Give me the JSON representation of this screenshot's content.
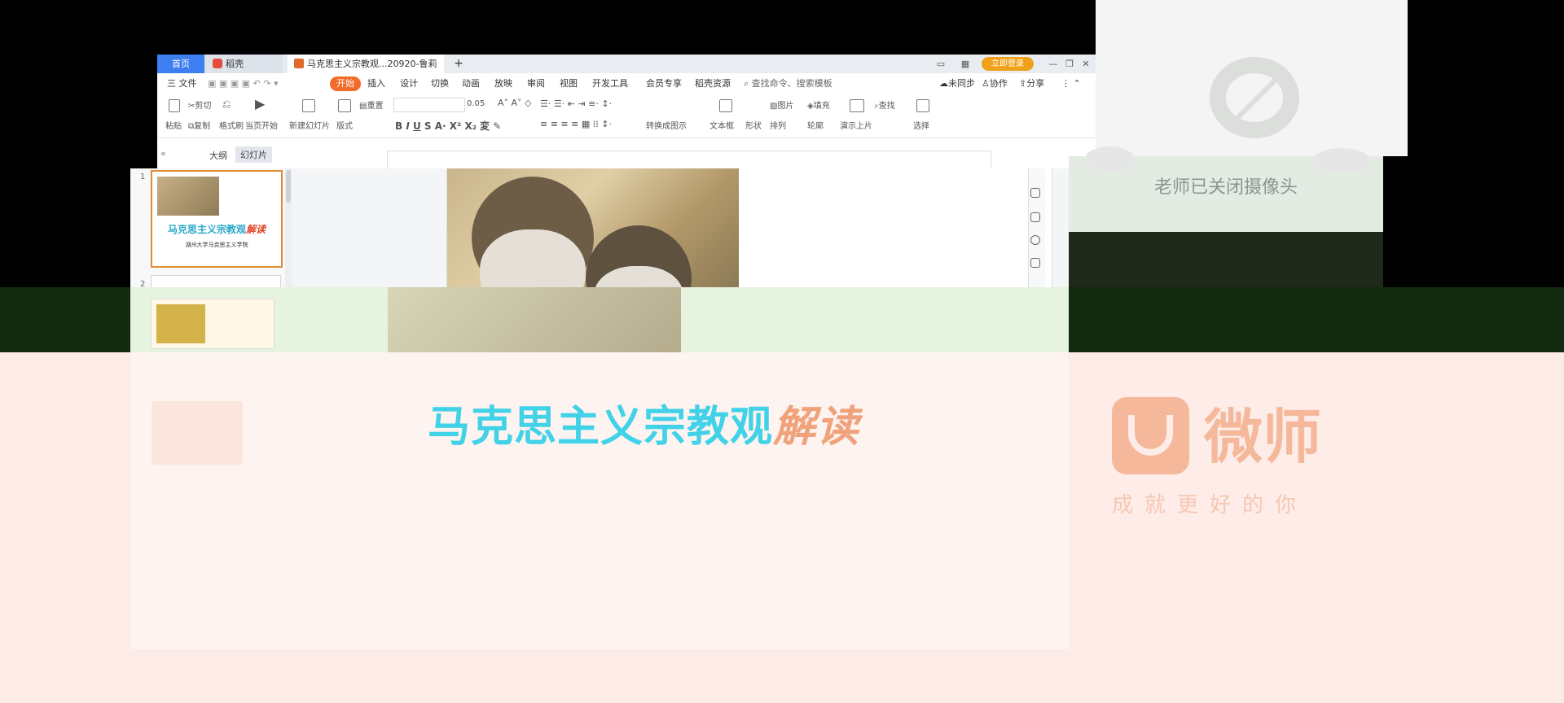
{
  "tabs": {
    "home": "首页",
    "docer": "稻壳",
    "document": "马克思主义宗教观...20920-鲁莉",
    "add": "+"
  },
  "window": {
    "login": "立即登录",
    "minimize": "—",
    "restore": "❐",
    "close": "✕"
  },
  "menu": {
    "file": "三 文件",
    "start": "开始",
    "insert": "插入",
    "design": "设计",
    "transition": "切换",
    "animation": "动画",
    "slideshow": "放映",
    "review": "审阅",
    "view": "视图",
    "developer": "开发工具",
    "member": "会员专享",
    "resources": "稻壳资源",
    "search": "查找命令、搜索模板",
    "unsync": "未同步",
    "collab": "协作",
    "share": "分享"
  },
  "ribbon": {
    "paste": "粘贴",
    "cut": "剪切",
    "copy": "复制",
    "format_painter": "格式刷",
    "play_from_start": "当页开始",
    "new_slide": "新建幻灯片",
    "layout": "版式",
    "reset": "重置",
    "font_size": "0.05",
    "text_box": "文本框",
    "shape": "形状",
    "arrange": "排列",
    "picture": "图片",
    "fill": "填充",
    "find": "查找",
    "present": "演示上片",
    "select": "选择",
    "smartart": "转换成图示",
    "outline": "轮廓"
  },
  "panel": {
    "outline_tab": "大纲",
    "slides_tab": "幻灯片"
  },
  "thumbnails": [
    {
      "number": "1",
      "title": "马克思主义宗教观",
      "title_accent": "解读",
      "subtitle": "湖州大学马克思主义学院"
    },
    {
      "number": "2"
    }
  ],
  "slide": {
    "title": "马克思主义宗教观",
    "title_accent": "解读"
  },
  "camera": {
    "status": "老师已关闭摄像头"
  },
  "brand": {
    "name": "微师",
    "slogan": "成就更好的你"
  },
  "colors": {
    "accent_orange": "#f26b2a",
    "tab_blue": "#3d7ef0",
    "title_cyan": "#42d2e8",
    "brand_peach": "#f6b89a"
  }
}
